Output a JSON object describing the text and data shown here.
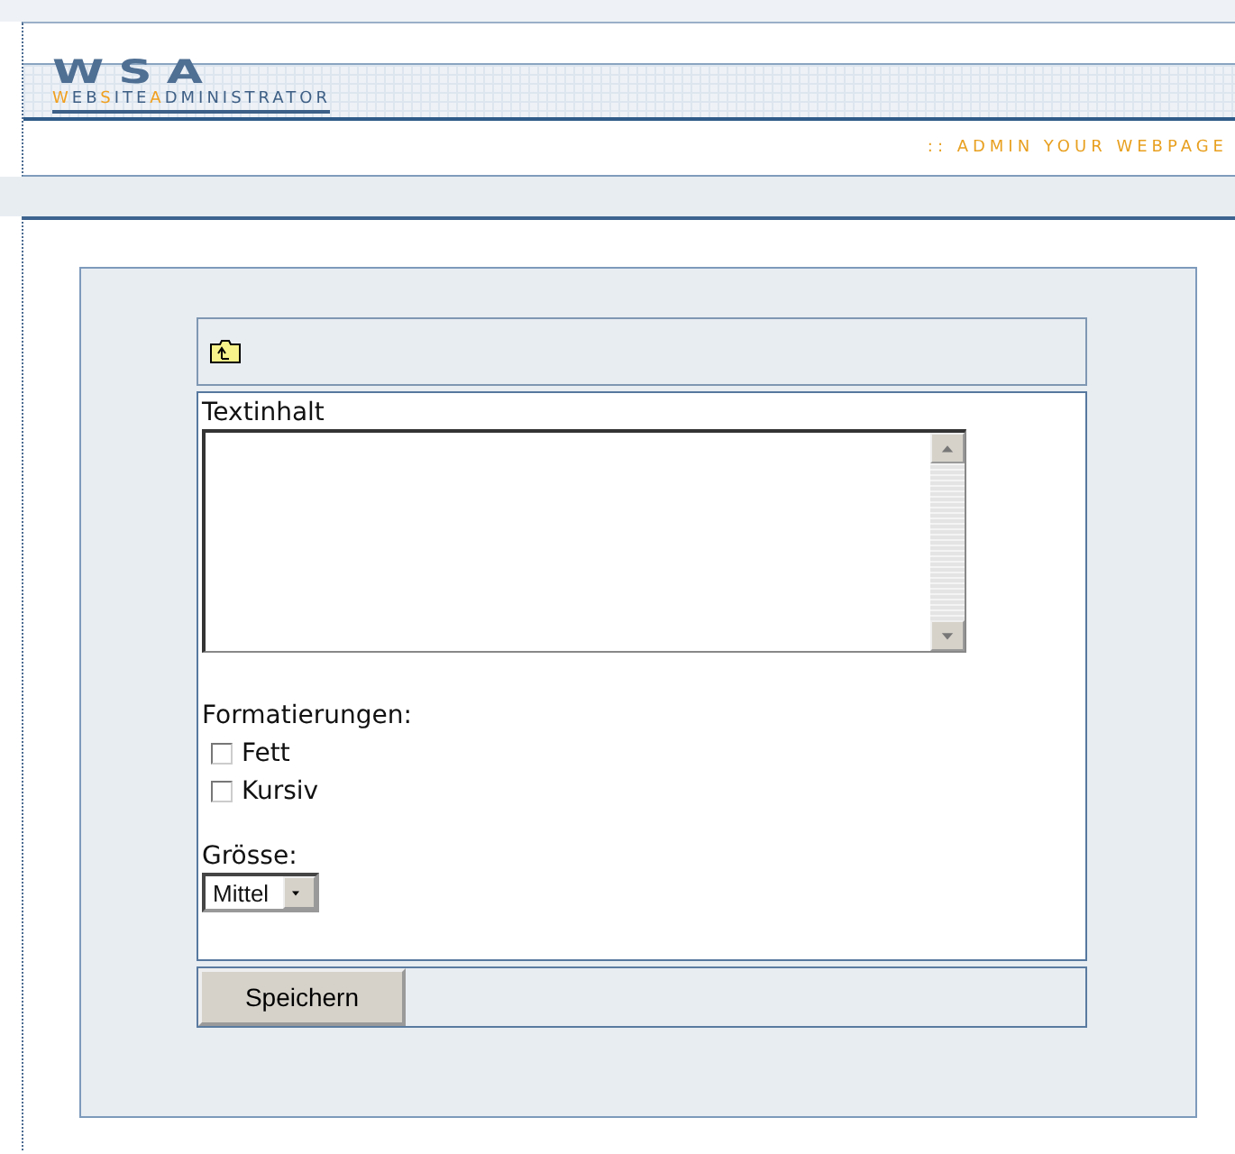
{
  "header": {
    "logo": "WSA",
    "logo_subtitle": [
      {
        "text": "W",
        "accent": true
      },
      {
        "text": "EB",
        "accent": false
      },
      {
        "text": "S",
        "accent": true
      },
      {
        "text": "ITE",
        "accent": false
      },
      {
        "text": "A",
        "accent": true
      },
      {
        "text": "DMINISTRATOR",
        "accent": false
      }
    ],
    "tagline": ":: ADMIN YOUR WEBPAGE"
  },
  "form": {
    "content_label": "Textinhalt",
    "formatting_label": "Formatierungen:",
    "options": [
      {
        "label": "Fett",
        "checked": false
      },
      {
        "label": "Kursiv",
        "checked": false
      }
    ],
    "size_label": "Grösse:",
    "size_value": "Mittel",
    "save_button": "Speichern"
  }
}
